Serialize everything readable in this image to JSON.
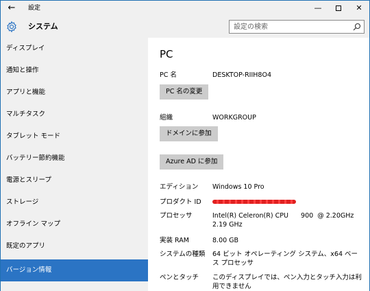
{
  "titlebar": {
    "back_glyph": "←",
    "title": "設定",
    "min_glyph": "—",
    "close_glyph": "✕"
  },
  "header": {
    "title": "システム",
    "search_placeholder": "設定の検索"
  },
  "sidebar": {
    "items": [
      {
        "label": "ディスプレイ"
      },
      {
        "label": "通知と操作"
      },
      {
        "label": "アプリと機能"
      },
      {
        "label": "マルチタスク"
      },
      {
        "label": "タブレット モード"
      },
      {
        "label": "バッテリー節約機能"
      },
      {
        "label": "電源とスリープ"
      },
      {
        "label": "ストレージ"
      },
      {
        "label": "オフライン マップ"
      },
      {
        "label": "既定のアプリ"
      },
      {
        "label": "バージョン情報",
        "active": true
      }
    ]
  },
  "main": {
    "heading": "PC",
    "pc_name_label": "PC 名",
    "pc_name_value": "DESKTOP-RIIH8O4",
    "rename_button": "PC 名の変更",
    "org_label": "組織",
    "org_value": "WORKGROUP",
    "join_domain_button": "ドメインに参加",
    "join_azure_button": "Azure AD に参加",
    "edition_label": "エディション",
    "edition_value": "Windows 10 Pro",
    "product_id_label": "プロダクト ID",
    "processor_label": "プロセッサ",
    "processor_value": "Intel(R) Celeron(R) CPU      900  @ 2.20GHz 2.19 GHz",
    "ram_label": "実装 RAM",
    "ram_value": "8.00 GB",
    "system_type_label": "システムの種類",
    "system_type_value": "64 ビット オペレーティング システム、x64 ベース プロセッサ",
    "pen_touch_label": "ペンとタッチ",
    "pen_touch_value": "このディスプレイでは、ペン入力とタッチ入力は利用できません"
  },
  "colors": {
    "accent": "#2b74c4",
    "sidebar_bg": "#f0f0f0",
    "button_bg": "#cccccc",
    "redaction": "#e02020"
  }
}
